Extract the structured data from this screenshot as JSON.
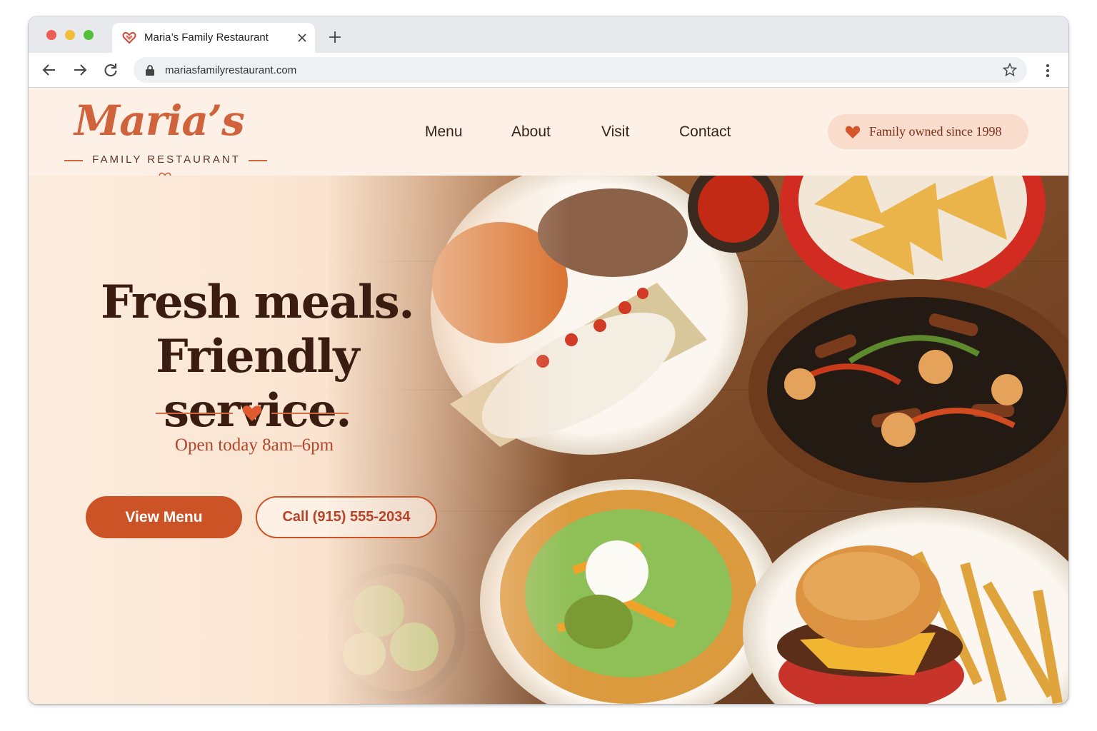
{
  "browser": {
    "tab_title": "Maria’s Family Restaurant",
    "url": "mariasfamilyrestaurant.com",
    "icons": [
      "back-icon",
      "forward-icon",
      "reload-icon",
      "lock-icon",
      "bookmark-star-icon",
      "more-icon",
      "close-icon",
      "plus-icon"
    ]
  },
  "site": {
    "logo": {
      "script": "Maria’s",
      "subtitle": "FAMILY RESTAURANT"
    },
    "nav": [
      "Menu",
      "About",
      "Visit",
      "Contact"
    ],
    "badge": "Family owned since 1998",
    "colors": {
      "accent": "#cc5325",
      "header_bg": "#fdf0e6",
      "headline": "#3a1c10"
    }
  },
  "hero": {
    "headline_line1": "Fresh meals.",
    "headline_line2": "Friendly service.",
    "hours": "Open today 8am–6pm",
    "primary_button": "View Menu",
    "secondary_button": "Call (915) 555-2034",
    "photo_items": [
      "enchiladas with rice and beans",
      "salsa bowl",
      "tortilla chips basket",
      "fajitas skillet",
      "taco salad",
      "limes bowl",
      "cheeseburger with fries"
    ]
  }
}
